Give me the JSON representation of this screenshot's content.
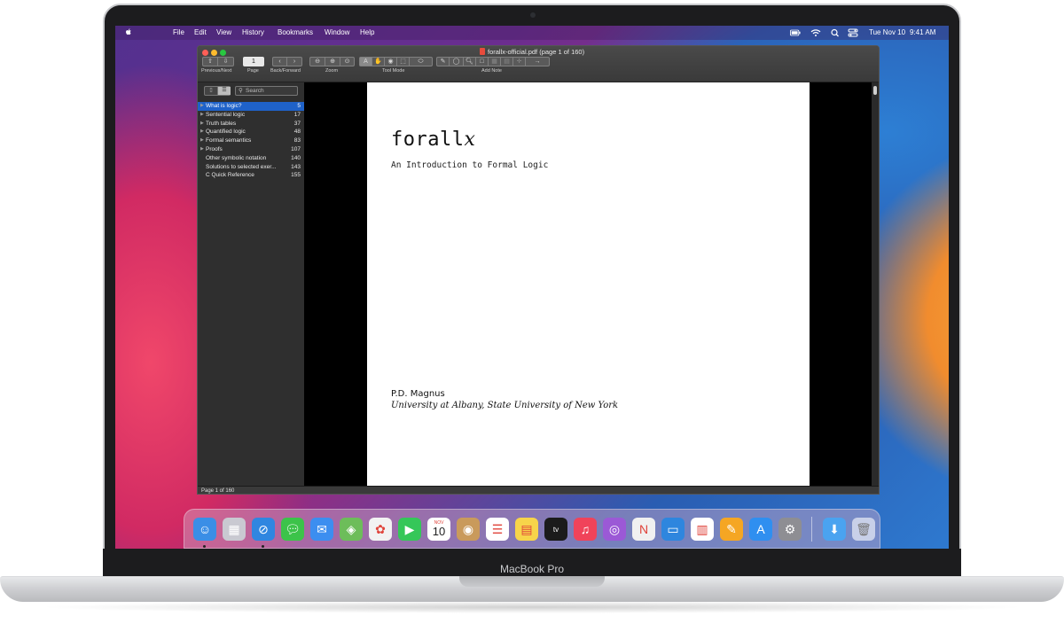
{
  "laptop": {
    "brand": "MacBook Pro"
  },
  "menubar": {
    "items": [
      "File",
      "Edit",
      "View",
      "History",
      "Bookmarks",
      "Window",
      "Help"
    ],
    "status_icons": [
      "battery-icon",
      "wifi-icon",
      "search-icon",
      "control-center-icon"
    ],
    "date": "Tue Nov 10",
    "time": "9:41 AM"
  },
  "window": {
    "title": "forallx-official.pdf (page 1 of 160)",
    "toolbar": {
      "page_value": "1",
      "labels": {
        "prev_next": "Previous/Next",
        "page": "Page",
        "back_forward": "Back/Forward",
        "zoom": "Zoom",
        "tool_mode": "Tool Mode",
        "add_note": "Add Note"
      }
    },
    "sidebar": {
      "search_placeholder": "Search",
      "toc": [
        {
          "title": "What is logic?",
          "page": "5",
          "has_children": true,
          "selected": true
        },
        {
          "title": "Sentential logic",
          "page": "17",
          "has_children": true,
          "selected": false
        },
        {
          "title": "Truth tables",
          "page": "37",
          "has_children": true,
          "selected": false
        },
        {
          "title": "Quantified logic",
          "page": "48",
          "has_children": true,
          "selected": false
        },
        {
          "title": "Formal semantics",
          "page": "83",
          "has_children": true,
          "selected": false
        },
        {
          "title": "Proofs",
          "page": "107",
          "has_children": true,
          "selected": false
        },
        {
          "title": "Other symbolic notation",
          "page": "140",
          "has_children": false,
          "selected": false
        },
        {
          "title": "Solutions to selected exer...",
          "page": "143",
          "has_children": false,
          "selected": false
        },
        {
          "title": "C Quick Reference",
          "page": "155",
          "has_children": false,
          "selected": false
        }
      ]
    },
    "document": {
      "title_main": "forall",
      "title_x": "x",
      "subtitle": "An Introduction to Formal Logic",
      "author": "P.D. Magnus",
      "affiliation": "University at Albany, State University of New York"
    },
    "status": "Page 1 of 160"
  },
  "dock": {
    "apps": [
      {
        "name": "finder-icon",
        "color": "#3a8ee6",
        "running": true
      },
      {
        "name": "launchpad-icon",
        "color": "#c9c9d1",
        "running": false
      },
      {
        "name": "safari-icon",
        "color": "#2f86e0",
        "running": true
      },
      {
        "name": "messages-icon",
        "color": "#3cc34a",
        "running": false
      },
      {
        "name": "mail-icon",
        "color": "#3c8ef0",
        "running": false
      },
      {
        "name": "maps-icon",
        "color": "#6dbd5a",
        "running": false
      },
      {
        "name": "photos-icon",
        "color": "#f2f2f2",
        "running": false
      },
      {
        "name": "facetime-icon",
        "color": "#35c759",
        "running": false
      },
      {
        "name": "calendar-icon",
        "color": "#ffffff",
        "running": false
      },
      {
        "name": "contacts-icon",
        "color": "#c99a5b",
        "running": false
      },
      {
        "name": "reminders-icon",
        "color": "#ffffff",
        "running": false
      },
      {
        "name": "notes-icon",
        "color": "#f7d44a",
        "running": false
      },
      {
        "name": "tv-icon",
        "color": "#1b1b1b",
        "running": false
      },
      {
        "name": "music-icon",
        "color": "#f0435a",
        "running": false
      },
      {
        "name": "podcasts-icon",
        "color": "#9b59d6",
        "running": false
      },
      {
        "name": "news-icon",
        "color": "#f0f0f0",
        "running": false
      },
      {
        "name": "keynote-icon",
        "color": "#2e86de",
        "running": false
      },
      {
        "name": "numbers-icon",
        "color": "#ffffff",
        "running": false
      },
      {
        "name": "pages-icon",
        "color": "#f5a623",
        "running": false
      },
      {
        "name": "app-store-icon",
        "color": "#2f8ff0",
        "running": false
      },
      {
        "name": "system-preferences-icon",
        "color": "#8e8e93",
        "running": false
      }
    ],
    "calendar_month": "NOV",
    "calendar_day": "10",
    "tv_label": "tv",
    "right": [
      "downloads-icon",
      "trash-icon"
    ]
  }
}
